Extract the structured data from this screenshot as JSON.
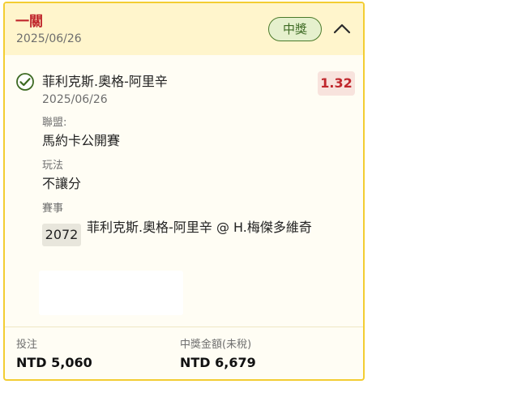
{
  "ticket": {
    "bet_type": "一關",
    "date": "2025/06/26",
    "status": "中獎",
    "colors": {
      "accent_red": "#c0282d",
      "border_yellow": "#f3cd32",
      "header_bg": "#fff5cc",
      "win_green": "#3d6a23"
    }
  },
  "leg": {
    "status_icon": "check-circle-icon",
    "selection": "菲利克斯.奧格-阿里辛",
    "date": "2025/06/26",
    "odds": "1.32",
    "league_label": "聯盟:",
    "league": "馬約卡公開賽",
    "market_label": "玩法",
    "market": "不讓分",
    "event_label": "賽事",
    "event_id": "2072",
    "event_name": "菲利克斯.奧格-阿里辛 @ H.梅傑多維奇"
  },
  "footer": {
    "stake_label": "投注",
    "stake_value": "NTD 5,060",
    "payout_label": "中獎金額(未稅)",
    "payout_value": "NTD 6,679"
  }
}
